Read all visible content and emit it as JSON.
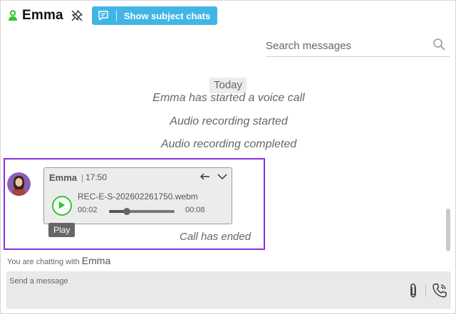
{
  "header": {
    "title": "Emma",
    "subject_button_label": "Show subject chats"
  },
  "search": {
    "placeholder": "Search messages"
  },
  "timeline": {
    "date_label": "Today",
    "events": [
      "Emma has started a voice call",
      "Audio recording started",
      "Audio recording completed"
    ],
    "call_ended": "Call has ended"
  },
  "message": {
    "sender": "Emma",
    "separator": "|",
    "time": "17:50",
    "file_name": "REC-E-S-202602261750.webm",
    "current_time": "00:02",
    "duration": "00:08",
    "progress": 0.27,
    "tooltip": "Play"
  },
  "footer": {
    "chatting_prefix": "You are chatting with",
    "chatting_name": "Emma",
    "compose_placeholder": "Send a message"
  },
  "colors": {
    "accent": "#41b6e6",
    "online": "#2fc72f",
    "highlight": "#8b2be2"
  },
  "icons": [
    "user-online-icon",
    "pin-off-icon",
    "chat-bubble-icon",
    "search-icon",
    "reply-icon",
    "chevron-down-icon",
    "play-icon",
    "paperclip-icon",
    "phone-icon"
  ]
}
